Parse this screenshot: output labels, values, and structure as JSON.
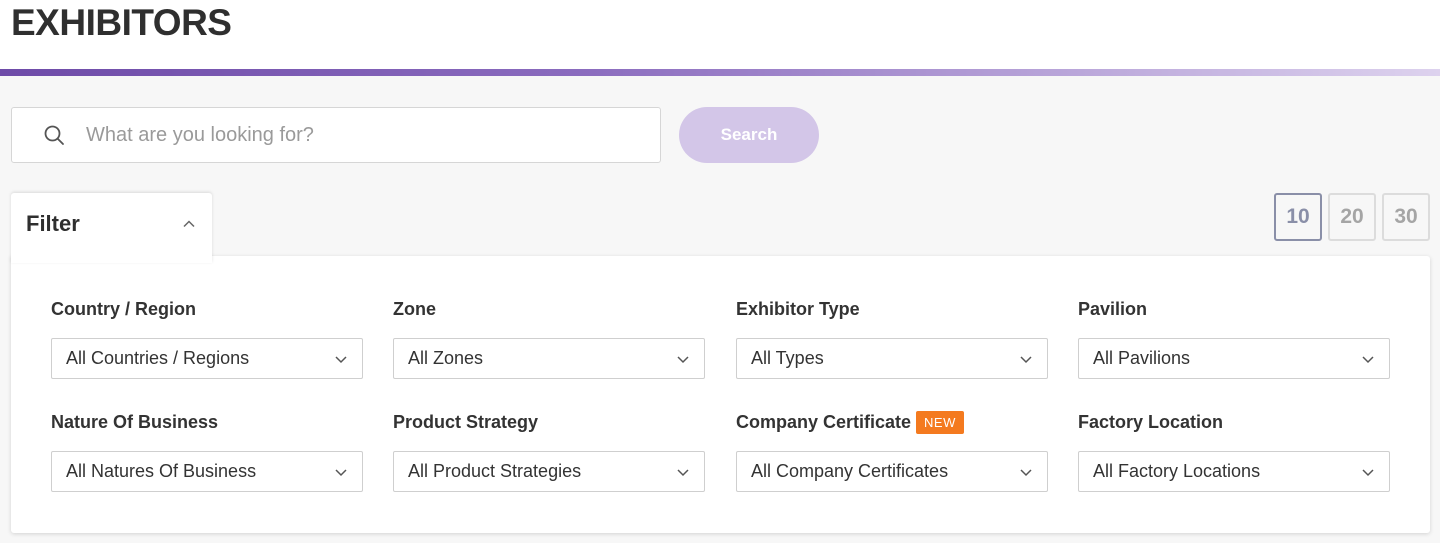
{
  "page": {
    "title": "EXHIBITORS"
  },
  "search": {
    "placeholder": "What are you looking for?",
    "button_label": "Search"
  },
  "filter": {
    "label": "Filter",
    "expanded": true,
    "fields": [
      {
        "label": "Country / Region",
        "value": "All Countries / Regions"
      },
      {
        "label": "Zone",
        "value": "All Zones"
      },
      {
        "label": "Exhibitor Type",
        "value": "All Types"
      },
      {
        "label": "Pavilion",
        "value": "All Pavilions"
      },
      {
        "label": "Nature Of Business",
        "value": "All Natures Of Business"
      },
      {
        "label": "Product Strategy",
        "value": "All Product Strategies"
      },
      {
        "label": "Company Certificate",
        "badge": "NEW",
        "value": "All Company Certificates"
      },
      {
        "label": "Factory Location",
        "value": "All Factory Locations"
      }
    ]
  },
  "page_sizes": {
    "options": [
      "10",
      "20",
      "30"
    ],
    "selected": "10"
  },
  "icons": {
    "search": "search-icon",
    "collapse": "chevron-up-icon",
    "dropdown": "chevron-down-icon"
  },
  "colors": {
    "accent": "#6e4ba8",
    "search_button": "#d3c6e8",
    "new_badge": "#f47a1f"
  }
}
